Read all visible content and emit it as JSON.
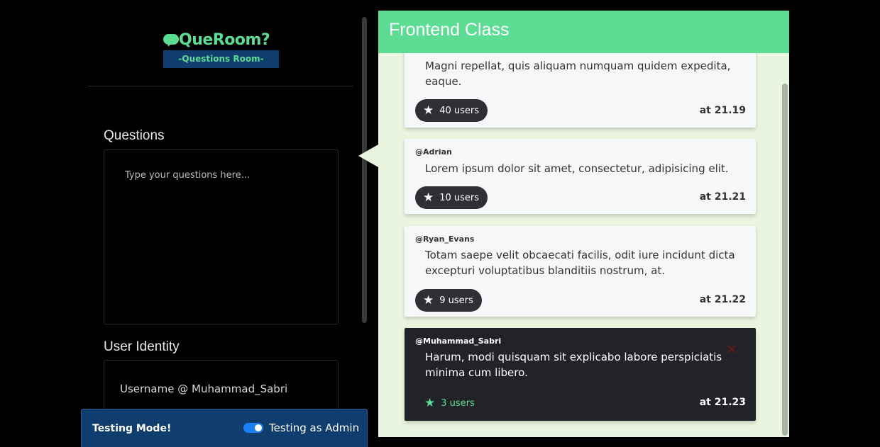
{
  "brand": {
    "title": "QueRoom?",
    "subtitle": "-Questions Room-",
    "accent": "#5ddc94",
    "subtitle_bg": "#0e3d6e"
  },
  "form": {
    "questions_label": "Questions",
    "questions_placeholder": "Type your questions here...",
    "identity_label": "User Identity",
    "identity_value": "Username @ Muhammad_Sabri"
  },
  "testing": {
    "title": "Testing Mode!",
    "toggle_label": "Testing as Admin",
    "toggle_on": true
  },
  "panel": {
    "title": "Frontend Class",
    "questions": [
      {
        "user": "",
        "text": "Magni repellat, quis aliquam numquam quidem expedita, eaque.",
        "likes": "40 users",
        "time": "at 21.19",
        "dark": false
      },
      {
        "user": "@Adrian",
        "text": "Lorem ipsum dolor sit amet, consectetur, adipisicing elit.",
        "likes": "10 users",
        "time": "at 21.21",
        "dark": false
      },
      {
        "user": "@Ryan_Evans",
        "text": "Totam saepe velit obcaecati facilis, odit iure incidunt dicta excepturi voluptatibus blanditiis nostrum, at.",
        "likes": "9 users",
        "time": "at 21.22",
        "dark": false
      },
      {
        "user": "@Muhammad_Sabri",
        "text": "Harum, modi quisquam sit explicabo labore perspiciatis minima cum libero.",
        "likes": "3 users",
        "time": "at 21.23",
        "dark": true,
        "delete_icon": "close-icon"
      }
    ]
  }
}
